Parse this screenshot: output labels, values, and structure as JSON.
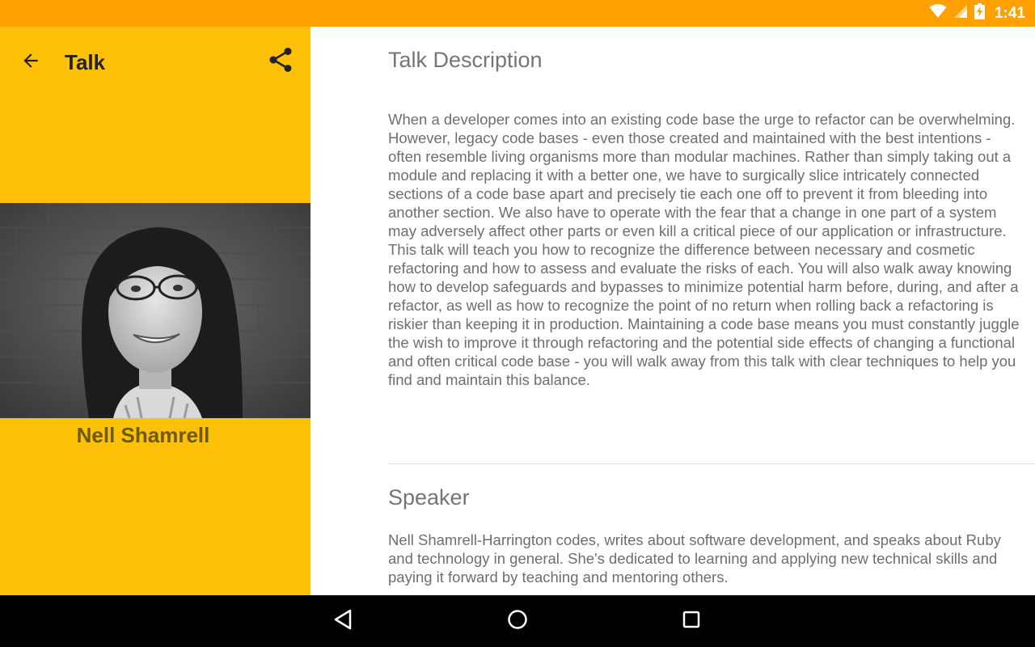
{
  "status_bar": {
    "time": "1:41",
    "icons": [
      "wifi-icon",
      "cell-signal-icon",
      "battery-charging-icon"
    ],
    "color": "#FFA000"
  },
  "toolbar": {
    "title": "Talk",
    "back_icon": "arrow-back-icon",
    "share_icon": "share-icon"
  },
  "speaker_card": {
    "name": "Nell Shamrell",
    "photo": "speaker-photo",
    "background_color": "#FFC107"
  },
  "talk": {
    "description_title": "Talk Description",
    "description": "When a developer comes into an existing code base the urge to refactor can be overwhelming. However, legacy code bases - even those created and maintained with the best intentions - often resemble living organisms more than modular machines. Rather than simply taking out a module and replacing it with a better one, we have to surgically slice intricately connected sections of a code base apart and precisely tie each one off to prevent it from bleeding into another section. We also have to operate with the fear that a change in one part of a system may adversely affect other parts or even kill a critical piece of our application or infrastructure. This talk will teach you how to recognize the difference between necessary and cosmetic refactoring and how to assess and evaluate the risks of each. You will also walk away knowing how to develop safeguards and bypasses to minimize potential harm before, during, and after a refactor, as well as how to recognize the point of no return when rolling back a refactoring is riskier than keeping it in production. Maintaining a code base means you must constantly juggle the wish to improve it through refactoring and the potential side effects of changing a functional and often critical code base - you will walk away from this talk with clear techniques to help you find and maintain this balance.",
    "speaker_title": "Speaker",
    "speaker_bio": "Nell Shamrell-Harrington codes, writes about software development, and speaks about Ruby and technology in general. She's dedicated to learning and applying new technical skills and paying it forward by teaching and mentoring others."
  },
  "nav_bar": {
    "buttons": [
      "nav-back-icon",
      "nav-home-icon",
      "nav-recents-icon"
    ]
  }
}
